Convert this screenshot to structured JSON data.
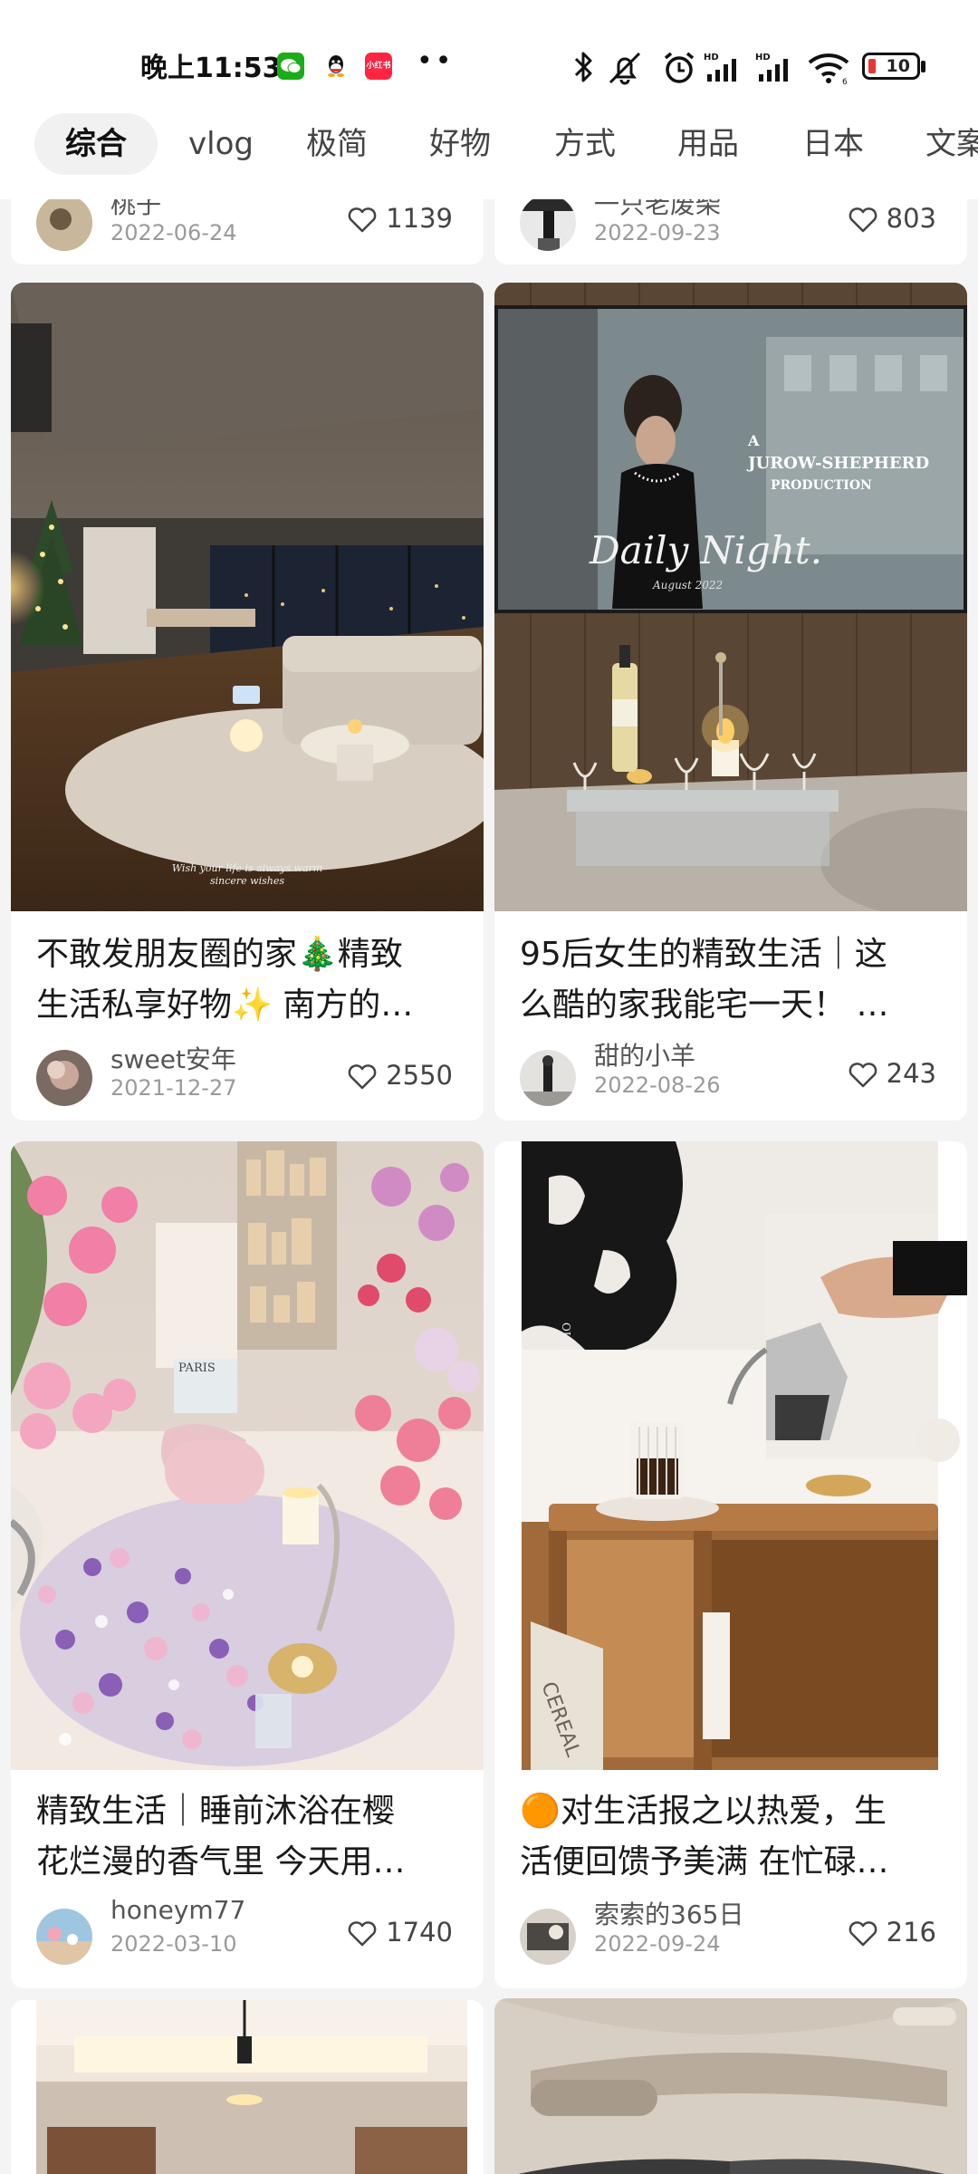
{
  "status": {
    "time": "晚上11:53",
    "apps": [
      "wechat-icon",
      "qq-icon",
      "xiaohongshu-icon"
    ],
    "xhs_label": "小红书",
    "battery": "10",
    "battery_color": "#e53935"
  },
  "tabs": [
    "综合",
    "vlog",
    "极简",
    "好物",
    "方式",
    "用品",
    "日本",
    "文案"
  ],
  "cards": [
    {
      "author": "桃子",
      "date": "2022-06-24",
      "likes": "1139"
    },
    {
      "author": "一只老废柴",
      "date": "2022-09-23",
      "likes": "803"
    },
    {
      "title_line1": "不敢发朋友圈的家🎄精致",
      "title_line2": "生活私享好物✨ 南方的…",
      "author": "sweet安年",
      "date": "2021-12-27",
      "likes": "2550",
      "image_caption1": "Wish your life is always warm",
      "image_caption2": "sincere wishes"
    },
    {
      "title_line1": "95后女生的精致生活｜这",
      "title_line2": "么酷的家我能宅一天！ …",
      "author": "甜的小羊",
      "date": "2022-08-26",
      "likes": "243",
      "screen_text1": "A",
      "screen_text2": "JUROW-SHEPHERD",
      "screen_text3": "PRODUCTION",
      "screen_text4": "Daily Night.",
      "screen_text5": "August 2022"
    },
    {
      "title_line1": "精致生活｜睡前沐浴在樱",
      "title_line2": "花烂漫的香气里 今天用…",
      "author": "honeym77",
      "date": "2022-03-10",
      "likes": "1740",
      "image_caption1": "PARIS"
    },
    {
      "title_line1": "🟠对生活报之以热爱，生",
      "title_line2": "活便回馈予美满 在忙碌…",
      "author": "索索的365日",
      "date": "2022-09-24",
      "likes": "216",
      "image_caption1": "OUR DAILY LIFE",
      "image_caption2": "CEREAL"
    }
  ]
}
